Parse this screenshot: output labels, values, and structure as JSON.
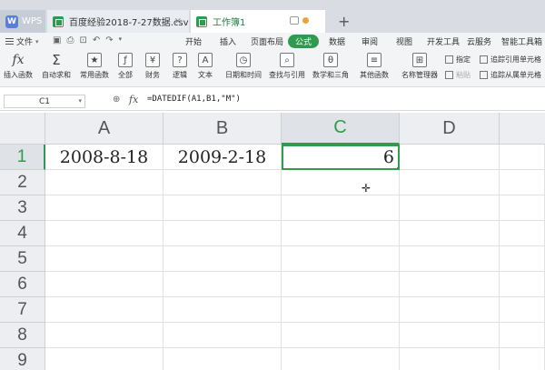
{
  "tabs": {
    "wps_label": "WPS",
    "csv_label": "百度经验2018-7-27数据.csv",
    "sheet_label": "工作簿1",
    "close_glyph": "×",
    "new_tab_glyph": "+"
  },
  "menubar": {
    "file_label": "文件",
    "items": [
      "开始",
      "插入",
      "页面布局",
      "公式",
      "数据",
      "审阅",
      "视图",
      "开发工具",
      "云服务",
      "智能工具箱"
    ],
    "active_item": "公式"
  },
  "ribbon": {
    "buttons": [
      "插入函数",
      "自动求和",
      "常用函数",
      "全部",
      "财务",
      "逻辑",
      "文本",
      "日期和时间",
      "查找与引用",
      "数学和三角",
      "其他函数",
      "名称管理器"
    ],
    "small": {
      "specify": "指定",
      "paste": "粘贴",
      "trace_precedents": "追踪引用单元格",
      "trace_dependents": "追踪从属单元格"
    },
    "icon_glyphs": {
      "fx": "fx",
      "sum": "Σ"
    }
  },
  "formula_bar": {
    "name_box": "C1",
    "fx_label": "fx",
    "formula": "=DATEDIF(A1,B1,\"M\")"
  },
  "grid": {
    "columns": [
      "A",
      "B",
      "C",
      "D"
    ],
    "selected_column": "C",
    "rows": [
      "1",
      "2",
      "3",
      "4",
      "5",
      "6",
      "7",
      "8",
      "9"
    ],
    "selected_row": "1",
    "cells": {
      "A1": "2008-8-18",
      "B1": "2009-2-18",
      "C1": "6"
    }
  },
  "colors": {
    "accent": "#2e9b4f",
    "header_bg": "#eceef1",
    "tabbar_bg": "#d9dde3"
  }
}
